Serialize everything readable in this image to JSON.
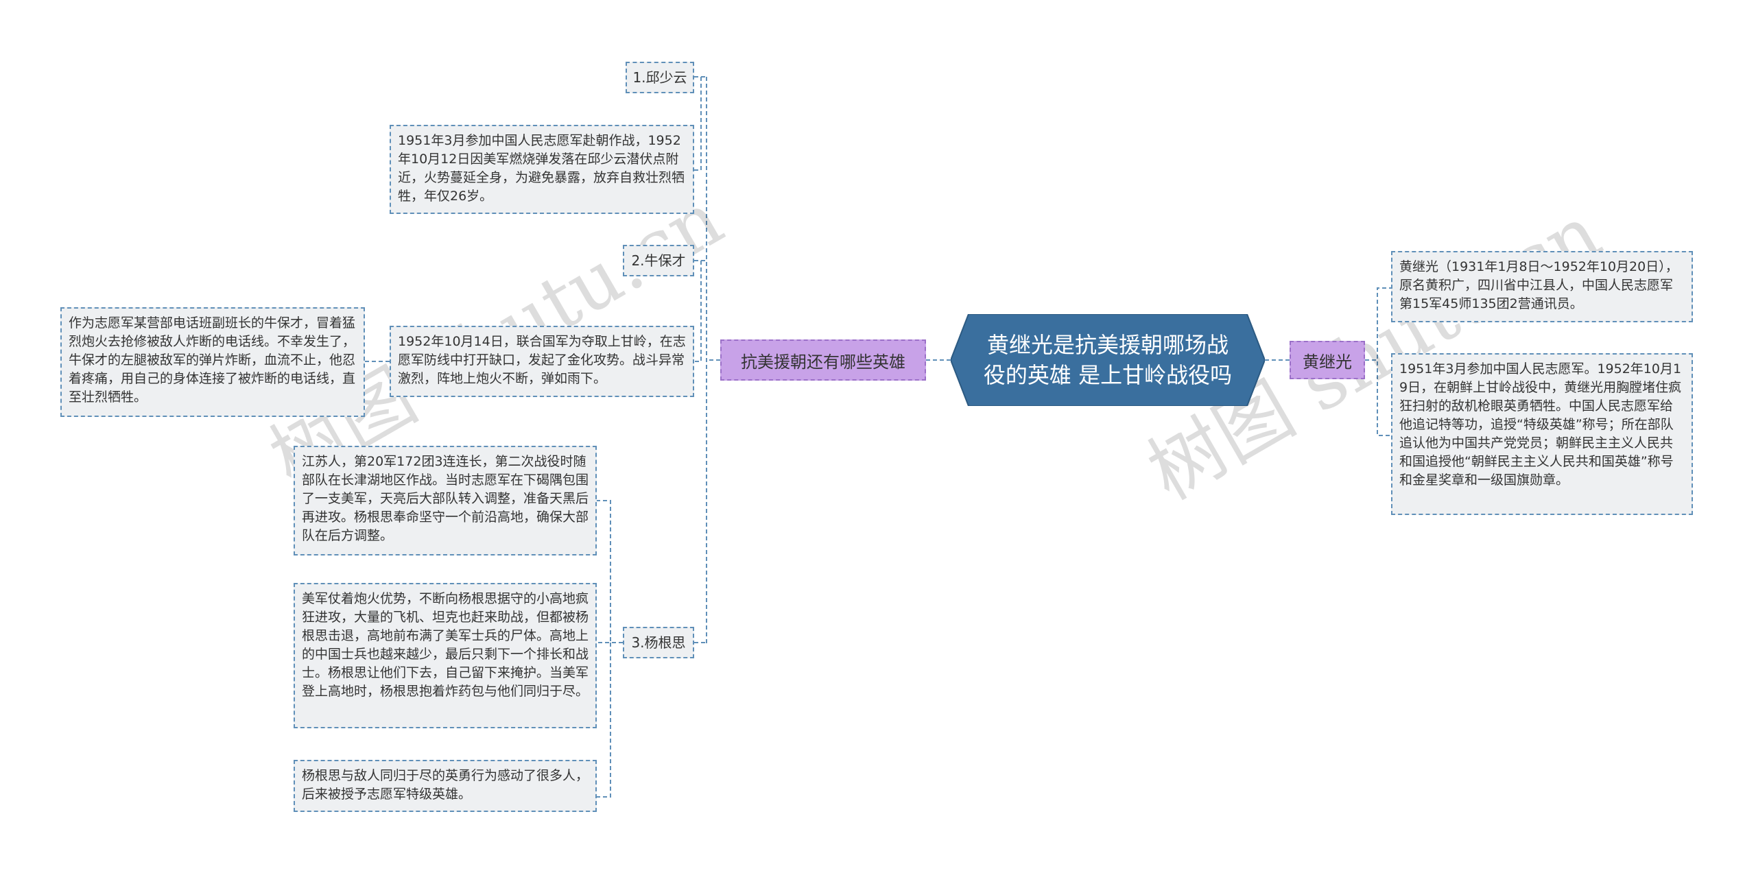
{
  "root": {
    "title": "黄继光是抗美援朝哪场战役的英雄 是上甘岭战役吗",
    "fill": "#3a6f9e"
  },
  "right": {
    "branch": "黄继光",
    "items": [
      "黄继光（1931年1月8日～1952年10月20日），原名黄积广，四川省中江县人，中国人民志愿军第15军45师135团2营通讯员。",
      "1951年3月参加中国人民志愿军。1952年10月19日，在朝鲜上甘岭战役中，黄继光用胸膛堵住疯狂扫射的敌机枪眼英勇牺牲。中国人民志愿军给他追记特等功，追授“特级英雄”称号；所在部队追认他为中国共产党党员；朝鲜民主主义人民共和国追授他“朝鲜民主主义人民共和国英雄”称号和金星奖章和一级国旗勋章。"
    ]
  },
  "left": {
    "branch": "抗美援朝还有哪些英雄",
    "heroes": [
      {
        "name": "1.邱少云",
        "desc": [
          "1951年3月参加中国人民志愿军赴朝作战，1952年10月12日因美军燃烧弹发落在邱少云潜伏点附近，火势蔓延全身，为避免暴露，放弃自救壮烈牺牲，年仅26岁。"
        ]
      },
      {
        "name": "2.牛保才",
        "desc": [
          "1952年10月14日，联合国军为夺取上甘岭，在志愿军防线中打开缺口，发起了金化攻势。战斗异常激烈，阵地上炮火不断，弹如雨下。"
        ],
        "sub": "作为志愿军某营部电话班副班长的牛保才，冒着猛烈炮火去抢修被敌人炸断的电话线。不幸发生了，牛保才的左腿被敌军的弹片炸断，血流不止，他忍着疼痛，用自己的身体连接了被炸断的电话线，直至壮烈牺牲。"
      },
      {
        "name": "3.杨根思",
        "desc": [
          "江苏人，第20军172团3连连长，第二次战役时随部队在长津湖地区作战。当时志愿军在下碣隅包围了一支美军，天亮后大部队转入调整，准备天黑后再进攻。杨根思奉命坚守一个前沿高地，确保大部队在后方调整。",
          "美军仗着炮火优势，不断向杨根思据守的小高地疯狂进攻，大量的飞机、坦克也赶来助战，但都被杨根思击退，高地前布满了美军士兵的尸体。高地上的中国士兵也越来越少，最后只剩下一个排长和战士。杨根思让他们下去，自己留下来掩护。当美军登上高地时，杨根思抱着炸药包与他们同归于尽。",
          "杨根思与敌人同归于尽的英勇行为感动了很多人，后来被授予志愿军特级英雄。"
        ]
      }
    ]
  },
  "watermarks": [
    "树图 shutu.cn",
    "树图 shutu.cn"
  ],
  "colors": {
    "line": "#5f8fb8",
    "node_border": "#5f8fb8",
    "node_fill": "#eef0f2",
    "branch_fill": "#c8a2e8",
    "root_fill": "#3a6f9e"
  }
}
